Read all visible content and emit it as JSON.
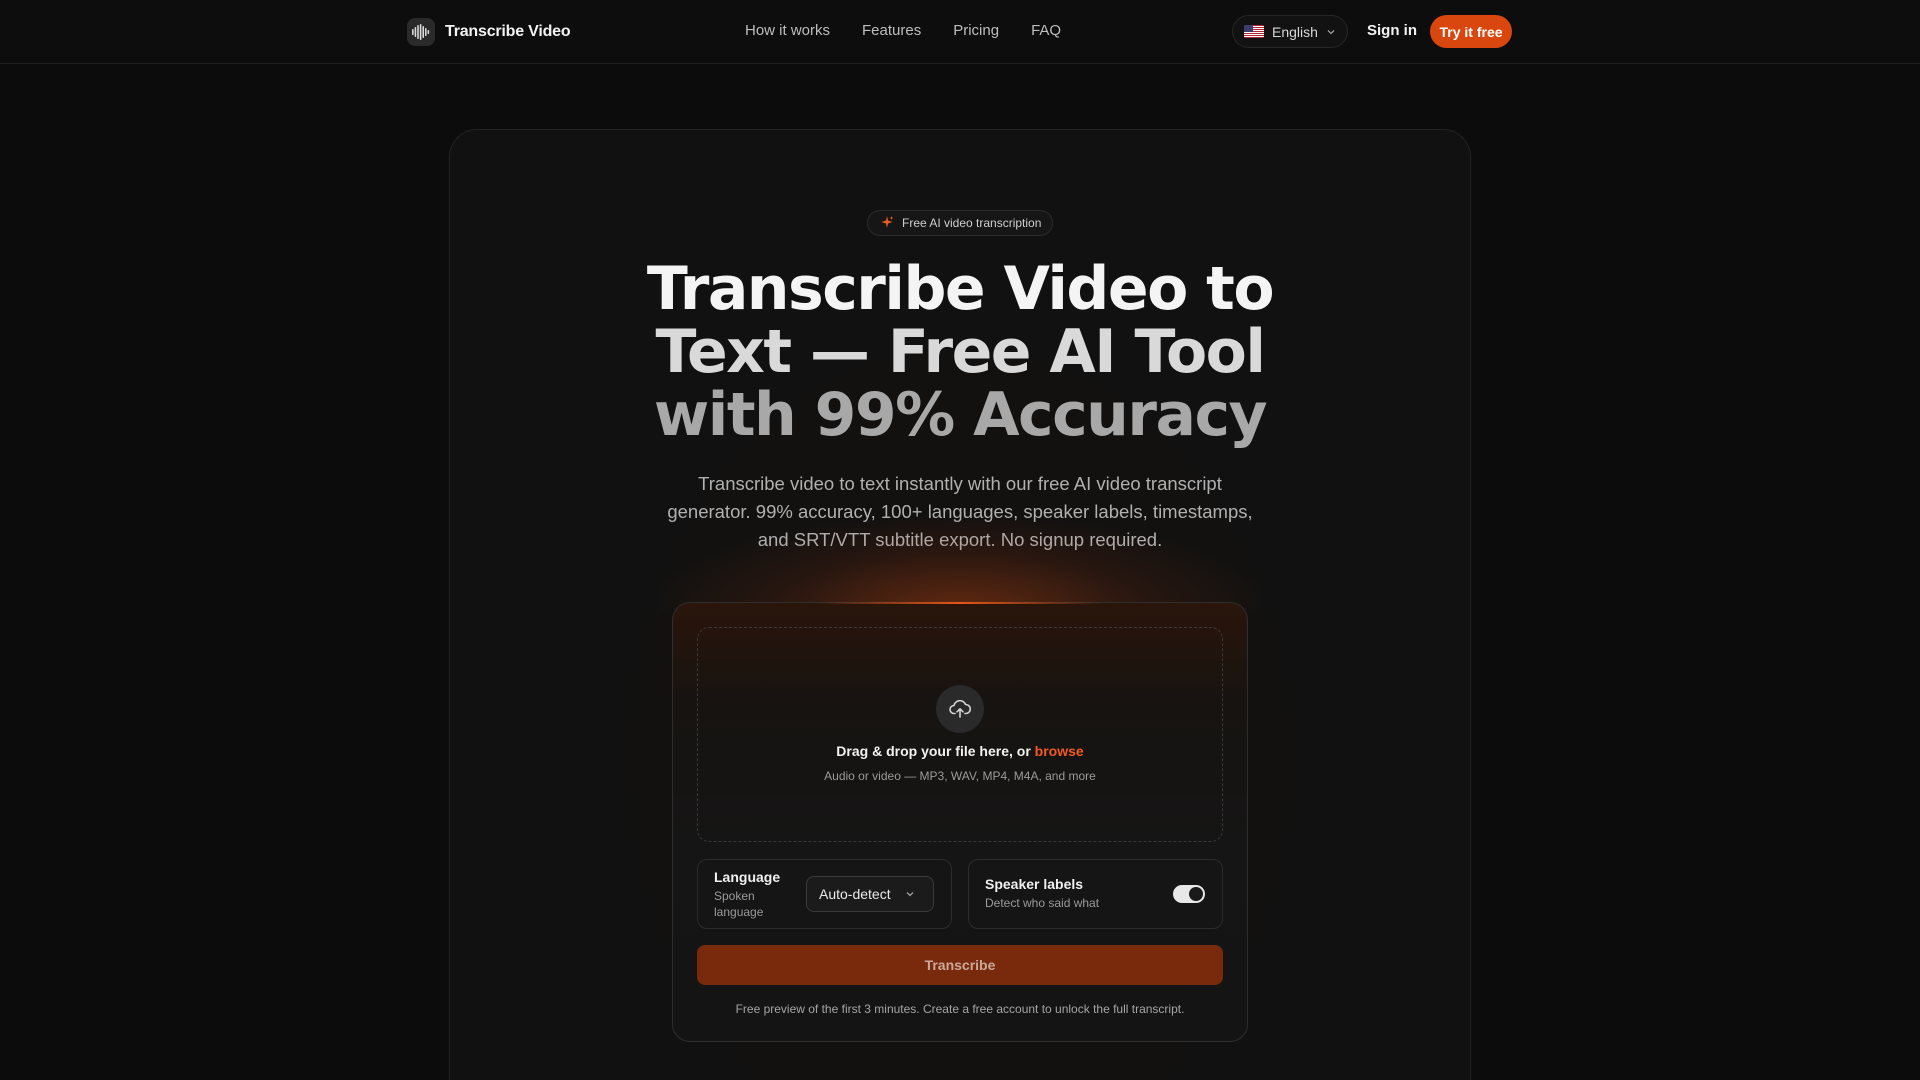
{
  "header": {
    "brand": "Transcribe Video",
    "nav": [
      "How it works",
      "Features",
      "Pricing",
      "FAQ"
    ],
    "language": "English",
    "signin": "Sign in",
    "cta": "Try it free"
  },
  "hero": {
    "badge": "Free AI video transcription",
    "headline_line1": "Transcribe Video to",
    "headline_line2": "Text — Free AI Tool",
    "headline_line3": "with 99% Accuracy",
    "subtitle": "Transcribe video to text instantly with our free AI video transcript generator. 99% accuracy, 100+ languages, speaker labels, timestamps, and SRT/VTT subtitle export. No signup required."
  },
  "upload": {
    "drop_prefix": "Drag & drop your file here, or ",
    "drop_link": "browse",
    "formats": "Audio or video — MP3, WAV, MP4, M4A, and more",
    "language_title": "Language",
    "language_sub": "Spoken language",
    "language_value": "Auto-detect",
    "speaker_title": "Speaker labels",
    "speaker_sub": "Detect who said what",
    "speaker_enabled": true,
    "submit": "Transcribe",
    "footnote": "Free preview of the first 3 minutes. Create a free account to unlock the full transcript."
  },
  "colors": {
    "accent": "#d9470f",
    "link": "#f05a22",
    "background": "#0c0c0c"
  },
  "icons": {
    "brand": "waveform-icon",
    "badge": "sparkle-icon",
    "language": "us-flag-icon",
    "language_chevron": "chevron-down-icon",
    "upload": "cloud-upload-icon",
    "select_chevron": "chevron-down-icon"
  }
}
